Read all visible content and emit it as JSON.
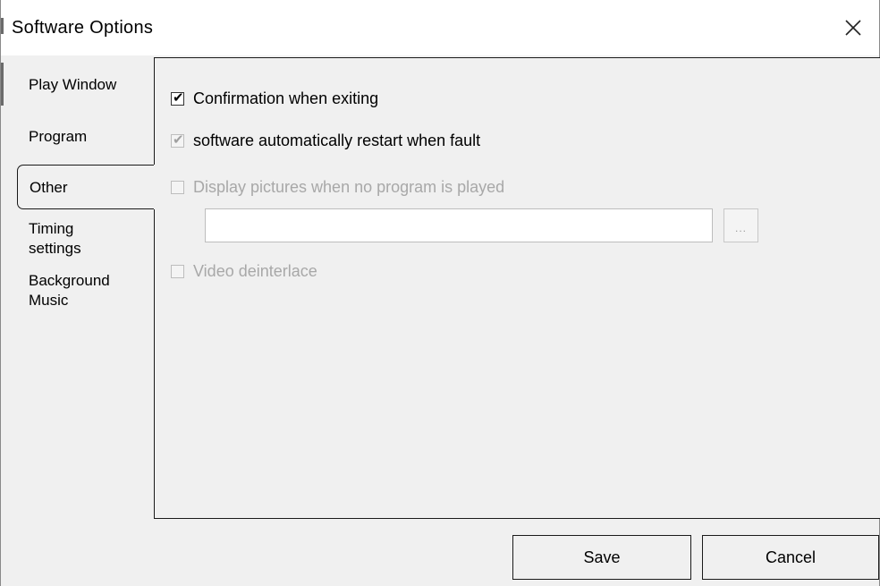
{
  "window": {
    "title": "Software Options",
    "close_icon": "close-icon"
  },
  "tabs": [
    {
      "line1": "Play Window",
      "line2": ""
    },
    {
      "line1": "Program",
      "line2": ""
    },
    {
      "line1": "Other",
      "line2": ""
    },
    {
      "line1": "Timing",
      "line2": "settings"
    },
    {
      "line1": "Background",
      "line2": "Music"
    }
  ],
  "active_tab": "Other",
  "options": {
    "confirm_exit": {
      "label": "Confirmation when exiting",
      "checked": true,
      "enabled": true
    },
    "auto_restart": {
      "label": "software automatically restart when fault",
      "checked": true,
      "enabled": false
    },
    "display_pictures": {
      "label": "Display pictures when no program is played",
      "checked": false,
      "enabled": false
    },
    "picture_path": {
      "value": "",
      "placeholder": ""
    },
    "browse_label": "...",
    "video_deinterlace": {
      "label": "Video deinterlace",
      "checked": false,
      "enabled": false
    }
  },
  "buttons": {
    "save": "Save",
    "cancel": "Cancel"
  },
  "colors": {
    "dialog_bg": "#f0f0f0",
    "titlebar_bg": "#ffffff",
    "disabled_text": "#a8a8a8",
    "border": "#1a1a1a"
  }
}
